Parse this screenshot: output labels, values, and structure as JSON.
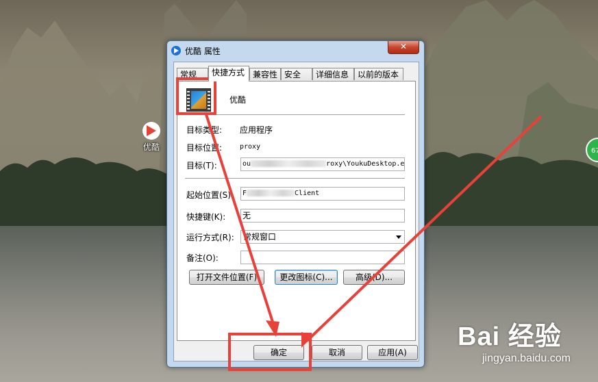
{
  "desktop": {
    "icon_label": "优酷",
    "badge_text": "67",
    "watermark_logo": "Bai 经验",
    "watermark_url": "jingyan.baidu.com"
  },
  "dialog": {
    "title": "优酷 属性",
    "close_glyph": "✕",
    "tabs": [
      {
        "label": "常规"
      },
      {
        "label": "快捷方式",
        "active": true
      },
      {
        "label": "兼容性"
      },
      {
        "label": "安全"
      },
      {
        "label": "详细信息"
      },
      {
        "label": "以前的版本"
      }
    ],
    "shortcut": {
      "app_name": "优酷",
      "target_type_label": "目标类型:",
      "target_type_value": "应用程序",
      "target_location_label": "目标位置:",
      "target_location_value": "proxy",
      "target_label": "目标(T):",
      "target_prefix": "ou",
      "target_suffix": "roxy\\YoukuDesktop.exe",
      "start_in_label": "起始位置(S):",
      "start_in_prefix": "F",
      "start_in_suffix": "Client",
      "hotkey_label": "快捷键(K):",
      "hotkey_value": "无",
      "run_label": "运行方式(R):",
      "run_value": "常规窗口",
      "comment_label": "备注(O):",
      "comment_value": "",
      "open_location_button": "打开文件位置(F)",
      "change_icon_button": "更改图标(C)...",
      "advanced_button": "高级(D)..."
    },
    "buttons": {
      "ok": "确定",
      "cancel": "取消",
      "apply": "应用(A)"
    }
  },
  "annotation_color": "#e8413a"
}
